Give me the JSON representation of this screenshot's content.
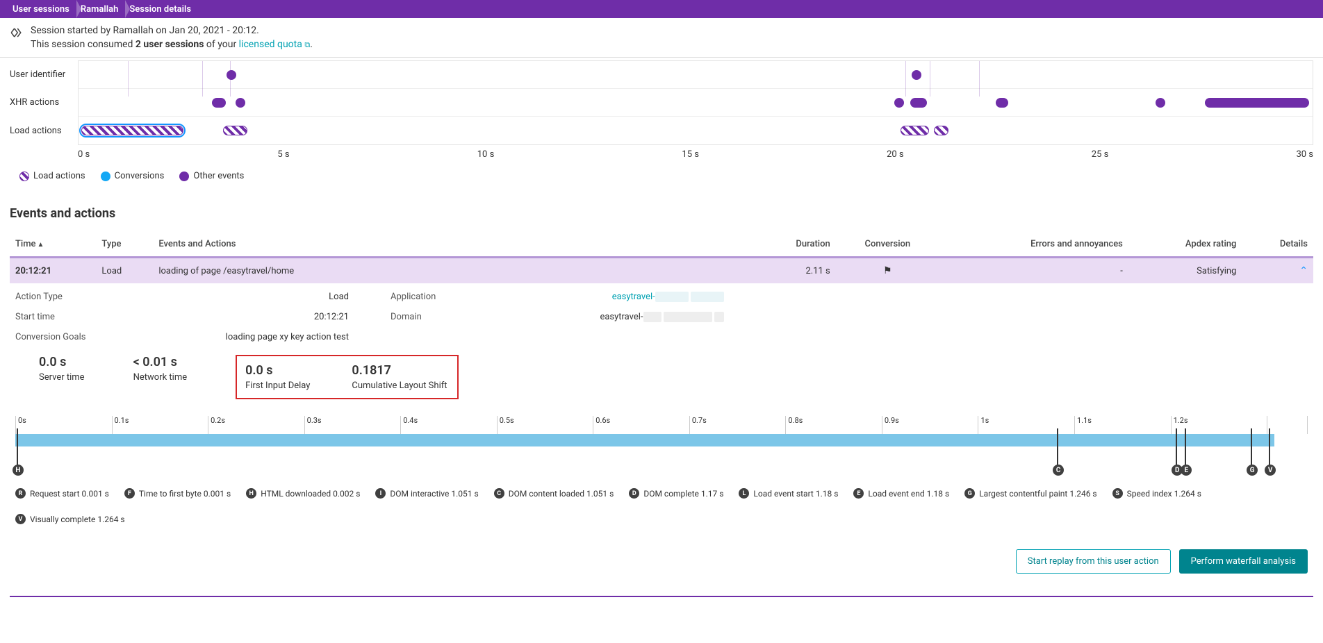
{
  "breadcrumb": [
    "User sessions",
    "Ramallah",
    "Session details"
  ],
  "header": {
    "line1_a": "Session started by Ramallah on Jan 20, 2021 - 20:12.",
    "line2_a": "This session consumed ",
    "line2_b": "2 user sessions",
    "line2_c": " of your ",
    "link": "licensed quota",
    "dot": "."
  },
  "timeline": {
    "row_labels": [
      "User identifier",
      "XHR actions",
      "Load actions"
    ],
    "xticks": [
      "0 s",
      "5 s",
      "10 s",
      "15 s",
      "20 s",
      "25 s",
      "30 s"
    ],
    "legend": [
      {
        "label": "Load actions",
        "type": "hatch"
      },
      {
        "label": "Conversions",
        "type": "conv",
        "color": "#14a8f5"
      },
      {
        "label": "Other events",
        "type": "dot",
        "color": "#6f2da8"
      }
    ]
  },
  "events_section_title": "Events and actions",
  "table": {
    "headers": [
      "Time",
      "Type",
      "Events and Actions",
      "Duration",
      "Conversion",
      "Errors and annoyances",
      "Apdex rating",
      "Details"
    ],
    "row": {
      "time": "20:12:21",
      "type": "Load",
      "event": "loading of page /easytravel/home",
      "duration": "2.11 s",
      "errors": "-",
      "apdex": "Satisfying"
    }
  },
  "details": {
    "action_type_l": "Action Type",
    "action_type_v": "Load",
    "start_time_l": "Start time",
    "start_time_v": "20:12:21",
    "conv_goals_l": "Conversion Goals",
    "conv_goals_v": "loading page xy key action test",
    "application_l": "Application",
    "application_v": "easytravel-",
    "domain_l": "Domain",
    "domain_v": "easytravel-"
  },
  "metrics": {
    "server_v": "0.0 s",
    "server_l": "Server time",
    "net_v": "< 0.01 s",
    "net_l": "Network time",
    "fid_v": "0.0 s",
    "fid_l": "First Input Delay",
    "cls_v": "0.1817",
    "cls_l": "Cumulative Layout Shift"
  },
  "ruler_ticks": [
    "0s",
    "0.1s",
    "0.2s",
    "0.3s",
    "0.4s",
    "0.5s",
    "0.6s",
    "0.7s",
    "0.8s",
    "0.9s",
    "1s",
    "1.1s",
    "1.2s",
    ""
  ],
  "chart_data": {
    "type": "table",
    "waterfall_metrics": [
      {
        "code": "R",
        "label": "Request start",
        "value": "0.001 s"
      },
      {
        "code": "F",
        "label": "Time to first byte",
        "value": "0.001 s"
      },
      {
        "code": "H",
        "label": "HTML downloaded",
        "value": "0.002 s"
      },
      {
        "code": "I",
        "label": "DOM interactive",
        "value": "1.051 s"
      },
      {
        "code": "C",
        "label": "DOM content loaded",
        "value": "1.051 s"
      },
      {
        "code": "D",
        "label": "DOM complete",
        "value": "1.17 s"
      },
      {
        "code": "L",
        "label": "Load event start",
        "value": "1.18 s"
      },
      {
        "code": "E",
        "label": "Load event end",
        "value": "1.18 s"
      },
      {
        "code": "G",
        "label": "Largest contentful paint",
        "value": "1.246 s"
      },
      {
        "code": "S",
        "label": "Speed index",
        "value": "1.264 s"
      },
      {
        "code": "V",
        "label": "Visually complete",
        "value": "1.264 s"
      }
    ]
  },
  "buttons": {
    "replay": "Start replay from this user action",
    "waterfall": "Perform waterfall analysis"
  }
}
